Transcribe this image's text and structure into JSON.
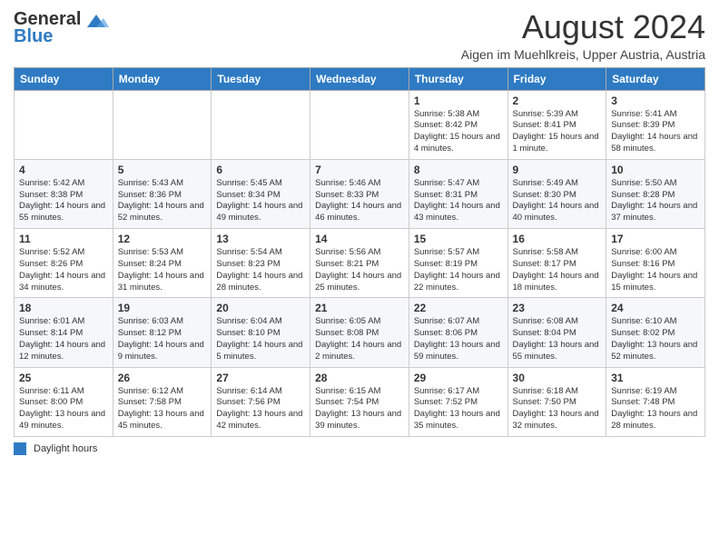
{
  "header": {
    "logo_general": "General",
    "logo_blue": "Blue",
    "month_title": "August 2024",
    "subtitle": "Aigen im Muehlkreis, Upper Austria, Austria"
  },
  "columns": [
    "Sunday",
    "Monday",
    "Tuesday",
    "Wednesday",
    "Thursday",
    "Friday",
    "Saturday"
  ],
  "weeks": [
    [
      {
        "day": "",
        "info": ""
      },
      {
        "day": "",
        "info": ""
      },
      {
        "day": "",
        "info": ""
      },
      {
        "day": "",
        "info": ""
      },
      {
        "day": "1",
        "info": "Sunrise: 5:38 AM\nSunset: 8:42 PM\nDaylight: 15 hours\nand 4 minutes."
      },
      {
        "day": "2",
        "info": "Sunrise: 5:39 AM\nSunset: 8:41 PM\nDaylight: 15 hours\nand 1 minute."
      },
      {
        "day": "3",
        "info": "Sunrise: 5:41 AM\nSunset: 8:39 PM\nDaylight: 14 hours\nand 58 minutes."
      }
    ],
    [
      {
        "day": "4",
        "info": "Sunrise: 5:42 AM\nSunset: 8:38 PM\nDaylight: 14 hours\nand 55 minutes."
      },
      {
        "day": "5",
        "info": "Sunrise: 5:43 AM\nSunset: 8:36 PM\nDaylight: 14 hours\nand 52 minutes."
      },
      {
        "day": "6",
        "info": "Sunrise: 5:45 AM\nSunset: 8:34 PM\nDaylight: 14 hours\nand 49 minutes."
      },
      {
        "day": "7",
        "info": "Sunrise: 5:46 AM\nSunset: 8:33 PM\nDaylight: 14 hours\nand 46 minutes."
      },
      {
        "day": "8",
        "info": "Sunrise: 5:47 AM\nSunset: 8:31 PM\nDaylight: 14 hours\nand 43 minutes."
      },
      {
        "day": "9",
        "info": "Sunrise: 5:49 AM\nSunset: 8:30 PM\nDaylight: 14 hours\nand 40 minutes."
      },
      {
        "day": "10",
        "info": "Sunrise: 5:50 AM\nSunset: 8:28 PM\nDaylight: 14 hours\nand 37 minutes."
      }
    ],
    [
      {
        "day": "11",
        "info": "Sunrise: 5:52 AM\nSunset: 8:26 PM\nDaylight: 14 hours\nand 34 minutes."
      },
      {
        "day": "12",
        "info": "Sunrise: 5:53 AM\nSunset: 8:24 PM\nDaylight: 14 hours\nand 31 minutes."
      },
      {
        "day": "13",
        "info": "Sunrise: 5:54 AM\nSunset: 8:23 PM\nDaylight: 14 hours\nand 28 minutes."
      },
      {
        "day": "14",
        "info": "Sunrise: 5:56 AM\nSunset: 8:21 PM\nDaylight: 14 hours\nand 25 minutes."
      },
      {
        "day": "15",
        "info": "Sunrise: 5:57 AM\nSunset: 8:19 PM\nDaylight: 14 hours\nand 22 minutes."
      },
      {
        "day": "16",
        "info": "Sunrise: 5:58 AM\nSunset: 8:17 PM\nDaylight: 14 hours\nand 18 minutes."
      },
      {
        "day": "17",
        "info": "Sunrise: 6:00 AM\nSunset: 8:16 PM\nDaylight: 14 hours\nand 15 minutes."
      }
    ],
    [
      {
        "day": "18",
        "info": "Sunrise: 6:01 AM\nSunset: 8:14 PM\nDaylight: 14 hours\nand 12 minutes."
      },
      {
        "day": "19",
        "info": "Sunrise: 6:03 AM\nSunset: 8:12 PM\nDaylight: 14 hours\nand 9 minutes."
      },
      {
        "day": "20",
        "info": "Sunrise: 6:04 AM\nSunset: 8:10 PM\nDaylight: 14 hours\nand 5 minutes."
      },
      {
        "day": "21",
        "info": "Sunrise: 6:05 AM\nSunset: 8:08 PM\nDaylight: 14 hours\nand 2 minutes."
      },
      {
        "day": "22",
        "info": "Sunrise: 6:07 AM\nSunset: 8:06 PM\nDaylight: 13 hours\nand 59 minutes."
      },
      {
        "day": "23",
        "info": "Sunrise: 6:08 AM\nSunset: 8:04 PM\nDaylight: 13 hours\nand 55 minutes."
      },
      {
        "day": "24",
        "info": "Sunrise: 6:10 AM\nSunset: 8:02 PM\nDaylight: 13 hours\nand 52 minutes."
      }
    ],
    [
      {
        "day": "25",
        "info": "Sunrise: 6:11 AM\nSunset: 8:00 PM\nDaylight: 13 hours\nand 49 minutes."
      },
      {
        "day": "26",
        "info": "Sunrise: 6:12 AM\nSunset: 7:58 PM\nDaylight: 13 hours\nand 45 minutes."
      },
      {
        "day": "27",
        "info": "Sunrise: 6:14 AM\nSunset: 7:56 PM\nDaylight: 13 hours\nand 42 minutes."
      },
      {
        "day": "28",
        "info": "Sunrise: 6:15 AM\nSunset: 7:54 PM\nDaylight: 13 hours\nand 39 minutes."
      },
      {
        "day": "29",
        "info": "Sunrise: 6:17 AM\nSunset: 7:52 PM\nDaylight: 13 hours\nand 35 minutes."
      },
      {
        "day": "30",
        "info": "Sunrise: 6:18 AM\nSunset: 7:50 PM\nDaylight: 13 hours\nand 32 minutes."
      },
      {
        "day": "31",
        "info": "Sunrise: 6:19 AM\nSunset: 7:48 PM\nDaylight: 13 hours\nand 28 minutes."
      }
    ]
  ],
  "footer": {
    "legend_label": "Daylight hours"
  }
}
